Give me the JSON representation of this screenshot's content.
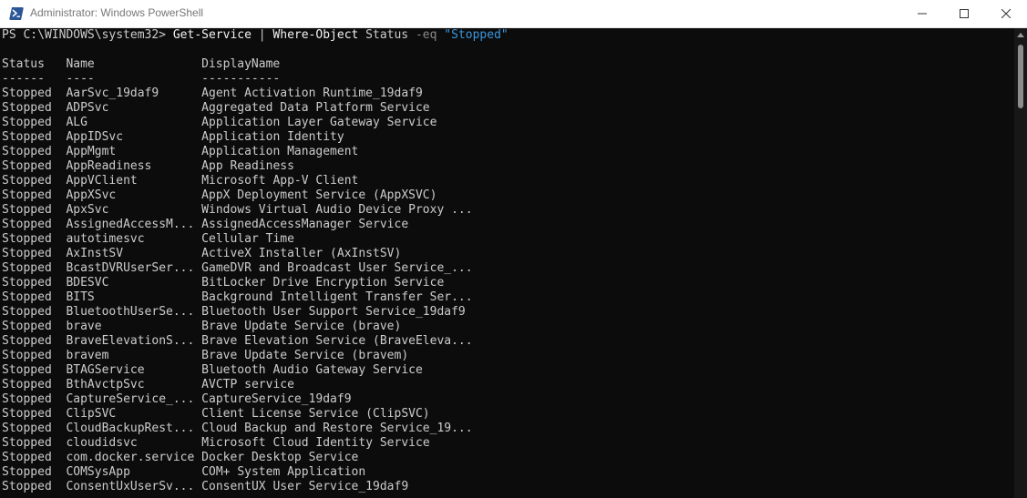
{
  "window": {
    "title": "Administrator: Windows PowerShell",
    "colors": {
      "background": "#0c0c0c",
      "text": "#cccccc",
      "command": "#f2f2f2",
      "parameter": "#8a8a8a",
      "string": "#3a96dd",
      "icon": "#2b5797"
    }
  },
  "console": {
    "prompt": {
      "path": "PS C:\\WINDOWS\\system32> ",
      "cmdlet": "Get-Service",
      "pipe": " | ",
      "filter": "Where-Object",
      "property": " Status ",
      "operator": "-eq",
      "value": " \"Stopped\""
    },
    "header": "Status   Name               DisplayName",
    "separator": "------   ----               -----------",
    "rows": [
      {
        "status": "Stopped",
        "name": "AarSvc_19daf9",
        "display": "Agent Activation Runtime_19daf9"
      },
      {
        "status": "Stopped",
        "name": "ADPSvc",
        "display": "Aggregated Data Platform Service"
      },
      {
        "status": "Stopped",
        "name": "ALG",
        "display": "Application Layer Gateway Service"
      },
      {
        "status": "Stopped",
        "name": "AppIDSvc",
        "display": "Application Identity"
      },
      {
        "status": "Stopped",
        "name": "AppMgmt",
        "display": "Application Management"
      },
      {
        "status": "Stopped",
        "name": "AppReadiness",
        "display": "App Readiness"
      },
      {
        "status": "Stopped",
        "name": "AppVClient",
        "display": "Microsoft App-V Client"
      },
      {
        "status": "Stopped",
        "name": "AppXSvc",
        "display": "AppX Deployment Service (AppXSVC)"
      },
      {
        "status": "Stopped",
        "name": "ApxSvc",
        "display": "Windows Virtual Audio Device Proxy ..."
      },
      {
        "status": "Stopped",
        "name": "AssignedAccessM...",
        "display": "AssignedAccessManager Service"
      },
      {
        "status": "Stopped",
        "name": "autotimesvc",
        "display": "Cellular Time"
      },
      {
        "status": "Stopped",
        "name": "AxInstSV",
        "display": "ActiveX Installer (AxInstSV)"
      },
      {
        "status": "Stopped",
        "name": "BcastDVRUserSer...",
        "display": "GameDVR and Broadcast User Service_..."
      },
      {
        "status": "Stopped",
        "name": "BDESVC",
        "display": "BitLocker Drive Encryption Service"
      },
      {
        "status": "Stopped",
        "name": "BITS",
        "display": "Background Intelligent Transfer Ser..."
      },
      {
        "status": "Stopped",
        "name": "BluetoothUserSe...",
        "display": "Bluetooth User Support Service_19daf9"
      },
      {
        "status": "Stopped",
        "name": "brave",
        "display": "Brave Update Service (brave)"
      },
      {
        "status": "Stopped",
        "name": "BraveElevationS...",
        "display": "Brave Elevation Service (BraveEleva..."
      },
      {
        "status": "Stopped",
        "name": "bravem",
        "display": "Brave Update Service (bravem)"
      },
      {
        "status": "Stopped",
        "name": "BTAGService",
        "display": "Bluetooth Audio Gateway Service"
      },
      {
        "status": "Stopped",
        "name": "BthAvctpSvc",
        "display": "AVCTP service"
      },
      {
        "status": "Stopped",
        "name": "CaptureService_...",
        "display": "CaptureService_19daf9"
      },
      {
        "status": "Stopped",
        "name": "ClipSVC",
        "display": "Client License Service (ClipSVC)"
      },
      {
        "status": "Stopped",
        "name": "CloudBackupRest...",
        "display": "Cloud Backup and Restore Service_19..."
      },
      {
        "status": "Stopped",
        "name": "cloudidsvc",
        "display": "Microsoft Cloud Identity Service"
      },
      {
        "status": "Stopped",
        "name": "com.docker.service",
        "display": "Docker Desktop Service"
      },
      {
        "status": "Stopped",
        "name": "COMSysApp",
        "display": "COM+ System Application"
      },
      {
        "status": "Stopped",
        "name": "ConsentUxUserSv...",
        "display": "ConsentUX User Service_19daf9"
      }
    ]
  }
}
